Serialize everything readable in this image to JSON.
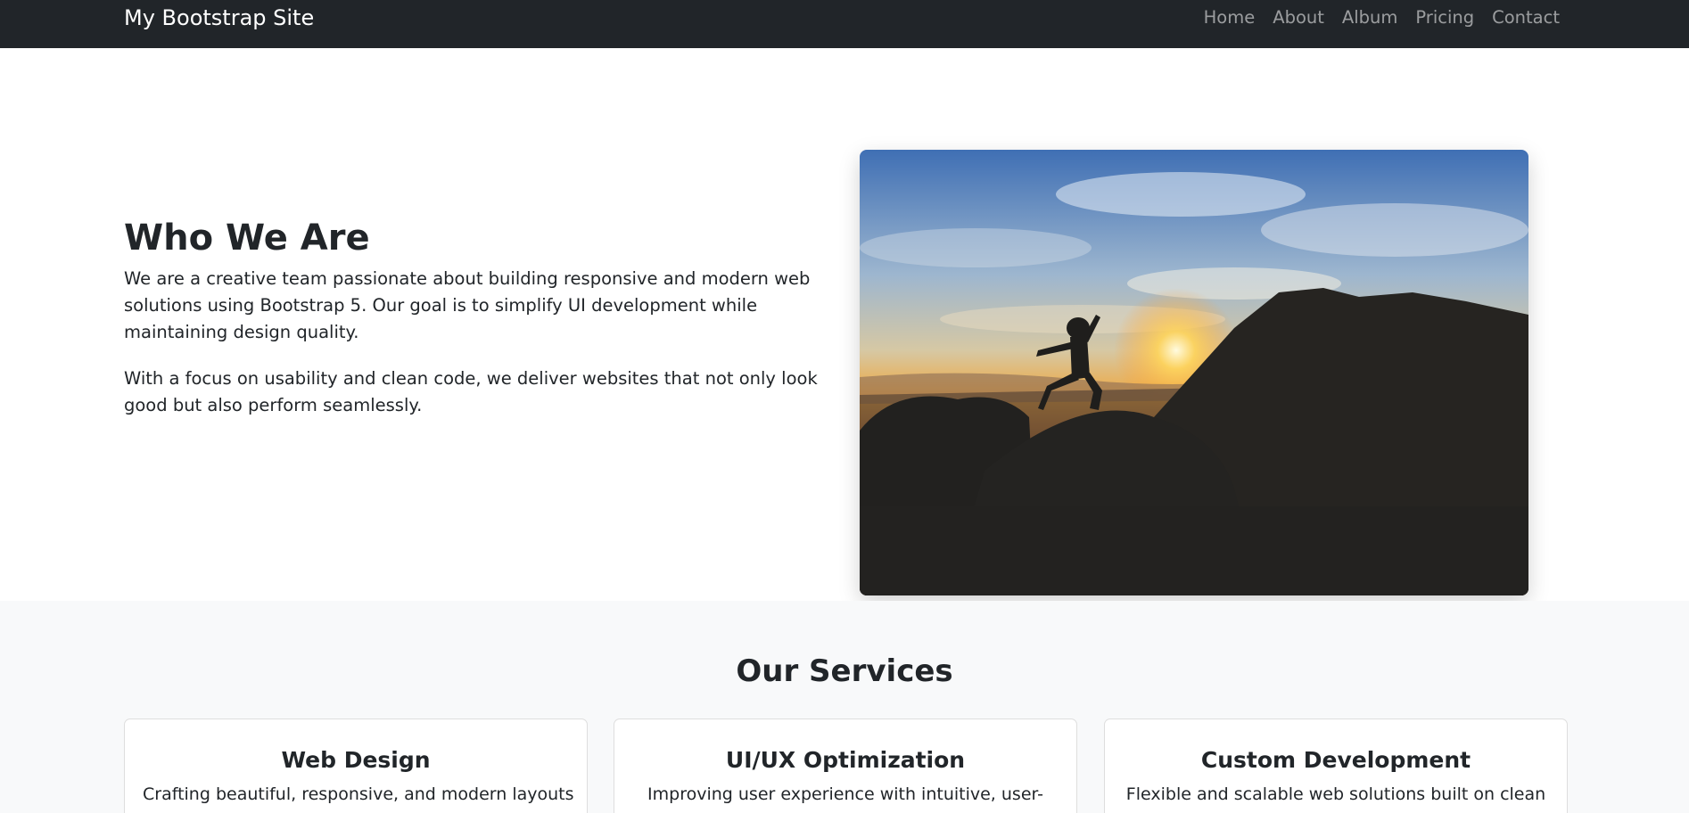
{
  "navbar": {
    "brand": "My Bootstrap Site",
    "links": [
      "Home",
      "About",
      "Album",
      "Pricing",
      "Contact"
    ],
    "background": "#212529"
  },
  "about": {
    "title": "Who We Are",
    "paragraph1": "We are a creative team passionate about building responsive and modern web solutions using Bootstrap 5. Our goal is to simplify UI development while maintaining design quality.",
    "paragraph2": "With a focus on usability and clean code, we deliver websites that not only look good but also perform seamlessly.",
    "image": "sunset-silhouette-jump-photo"
  },
  "services": {
    "title": "Our Services",
    "cards": [
      {
        "title": "Web Design",
        "text": "Crafting beautiful, responsive, and modern layouts"
      },
      {
        "title": "UI/UX Optimization",
        "text": "Improving user experience with intuitive, user-"
      },
      {
        "title": "Custom Development",
        "text": "Flexible and scalable web solutions built on clean"
      }
    ],
    "background": "#f8f9fa"
  }
}
